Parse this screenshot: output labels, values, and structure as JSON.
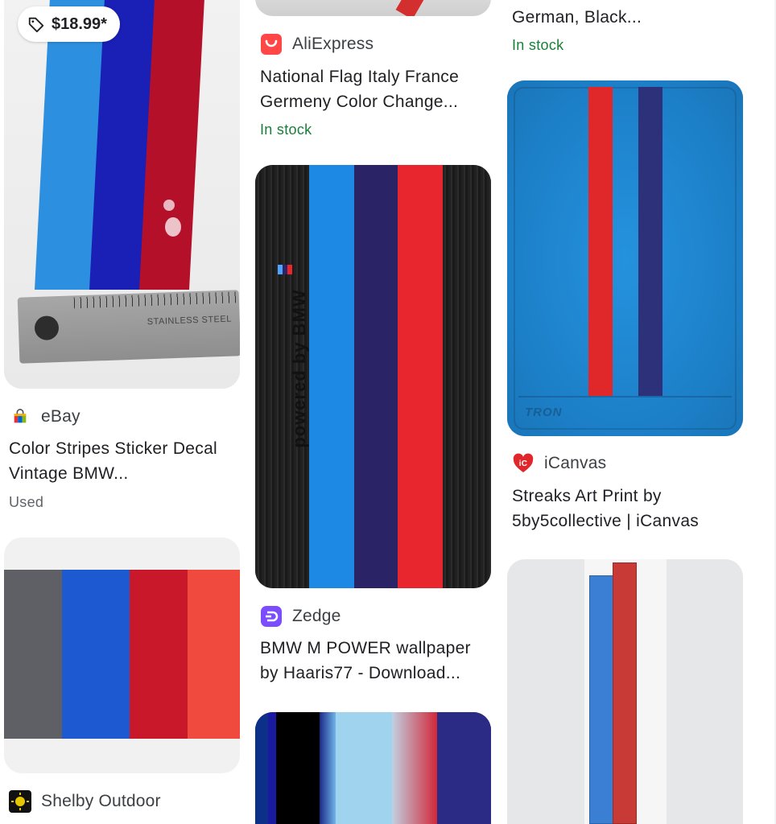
{
  "colors": {
    "in_stock_green": "#188038",
    "bmw_light_blue": "#1e88e5",
    "bmw_dark_blue": "#2a2466",
    "bmw_red": "#e8262e"
  },
  "col1": {
    "card1": {
      "price": "$18.99*",
      "price_icon": "tag-icon",
      "source": "eBay",
      "title": "Color Stripes Sticker Decal Vintage BMW...",
      "condition": "Used",
      "ruler_text": "STAINLESS STEEL"
    },
    "card2": {
      "source": "Shelby Outdoor"
    }
  },
  "col2": {
    "card1": {
      "source": "AliExpress",
      "title": "National Flag Italy France Germeny Color Change...",
      "availability": "In stock"
    },
    "card2": {
      "source": "Zedge",
      "title": "BMW M POWER wallpaper by Haaris77 - Download...",
      "image_text": "powered by BMW"
    }
  },
  "col3": {
    "card0": {
      "title": "German, Black...",
      "availability": "In stock"
    },
    "card1": {
      "source": "iCanvas",
      "title": "Streaks Art Print by 5by5collective | iCanvas",
      "image_text": "TRON"
    }
  }
}
